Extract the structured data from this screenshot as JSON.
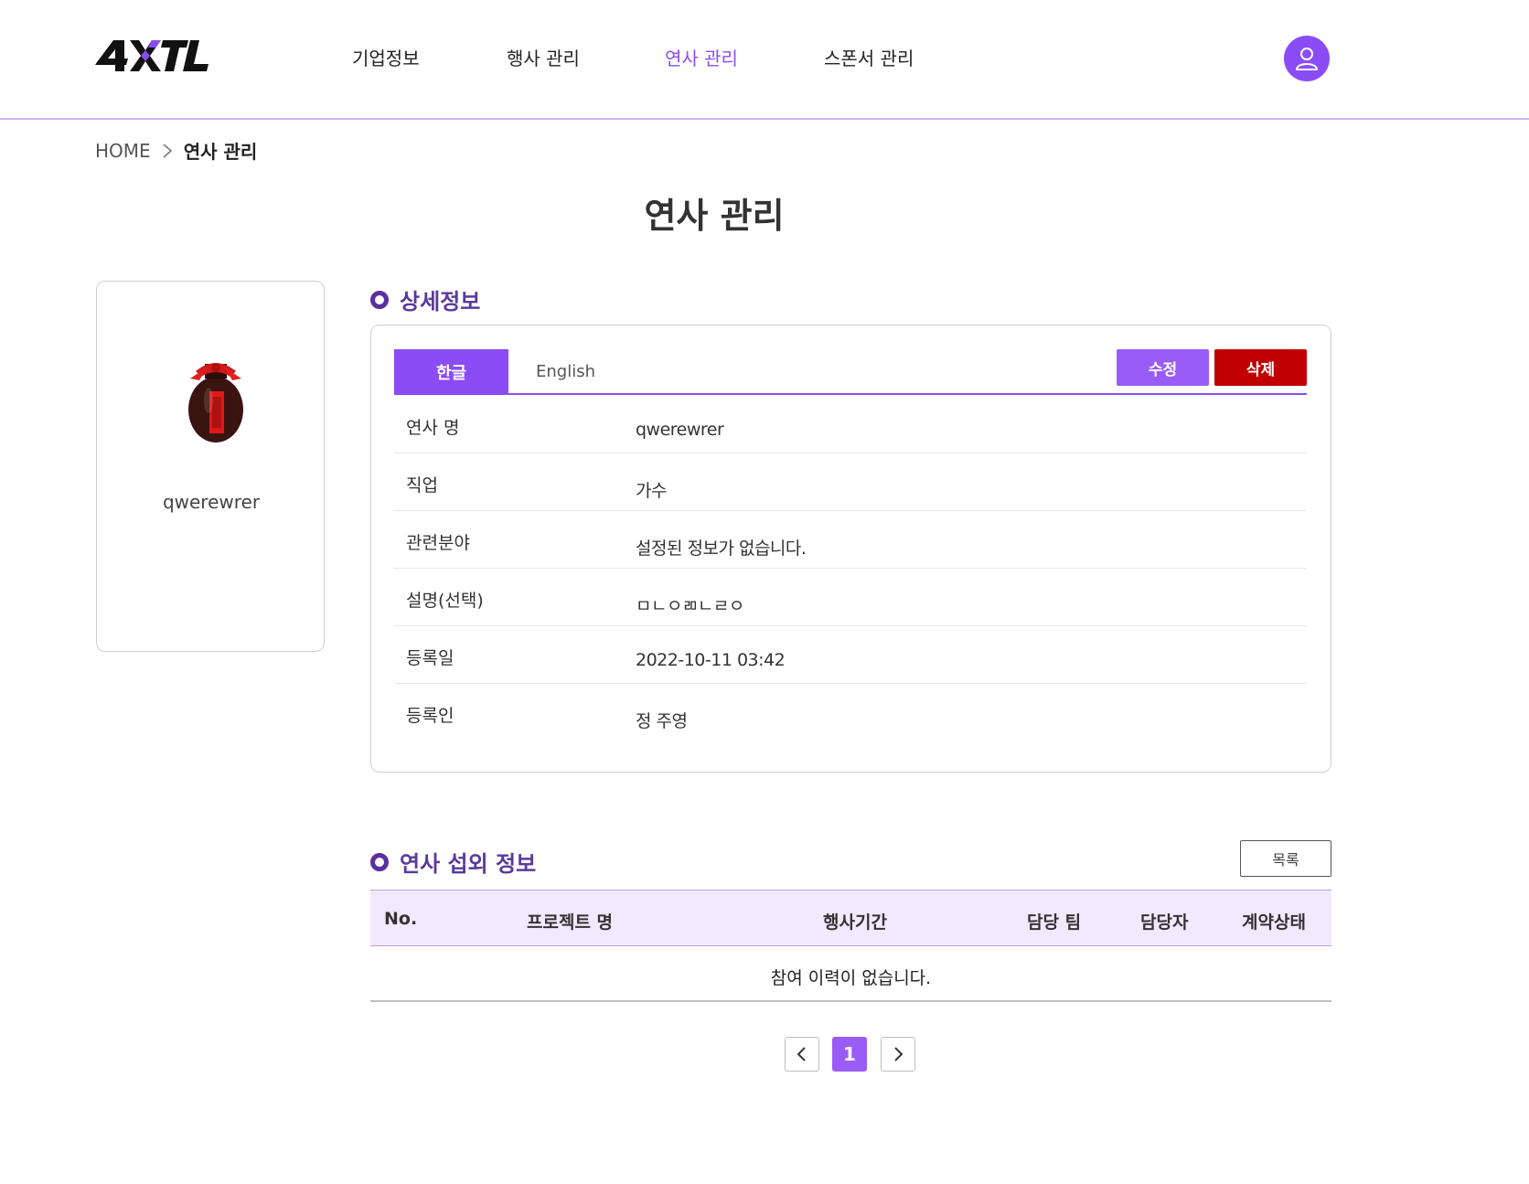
{
  "header": {
    "logo_text": "4XTL",
    "nav": [
      {
        "label": "기업정보"
      },
      {
        "label": "행사 관리"
      },
      {
        "label": "연사 관리"
      },
      {
        "label": "스폰서 관리"
      }
    ],
    "active_nav": "연사 관리"
  },
  "breadcrumb": {
    "home": "HOME",
    "current": "연사 관리"
  },
  "page_title": "연사 관리",
  "profile": {
    "name": "qwerewrer"
  },
  "detail": {
    "section_title": "상세정보",
    "tabs": [
      {
        "label": "한글"
      },
      {
        "label": "English"
      }
    ],
    "active_tab": "한글",
    "edit_label": "수정",
    "delete_label": "삭제",
    "rows": [
      {
        "label": "연사 명",
        "value": "qwerewrer"
      },
      {
        "label": "직업",
        "value": "가수"
      },
      {
        "label": "관련분야",
        "value": "설정된 정보가 없습니다."
      },
      {
        "label": "설명(선택)",
        "value": "ㅁㄴㅇㄻㄴㄹㅇ"
      },
      {
        "label": "등록일",
        "value": "2022-10-11 03:42"
      },
      {
        "label": "등록인",
        "value": "정 주영"
      }
    ]
  },
  "booking": {
    "section_title": "연사 섭외 정보",
    "list_button": "목록",
    "columns": [
      "No.",
      "프로젝트 명",
      "행사기간",
      "담당 팀",
      "담당자",
      "계약상태"
    ],
    "empty_text": "참여 이력이 없습니다."
  },
  "pagination": {
    "current": "1"
  },
  "colors": {
    "accent": "#8b4cf6",
    "delete": "#c00000",
    "section": "#5b2fa0",
    "table_header": "#f1e9fd"
  }
}
